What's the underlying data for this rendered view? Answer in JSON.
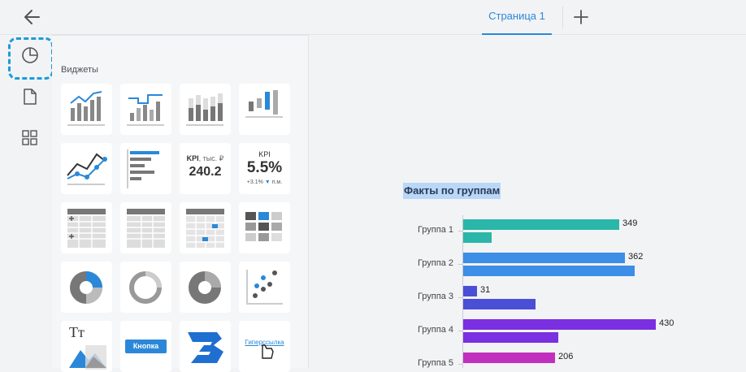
{
  "header": {
    "tab_label": "Страница 1",
    "back_icon": "arrow-left-icon",
    "add_icon": "plus-icon",
    "accent": "#2b88d8"
  },
  "sidebar": {
    "items": [
      {
        "icon": "pie-chart-icon",
        "active": true
      },
      {
        "icon": "document-icon",
        "active": false
      },
      {
        "icon": "grid-icon",
        "active": false
      }
    ]
  },
  "panel": {
    "title": "Виджеты",
    "kpi1": {
      "label": "KPI",
      "unit": ", тыс. ₽",
      "value": "240.2"
    },
    "kpi2": {
      "label": "KPI",
      "value": "5.5%",
      "delta": "+3.1%",
      "delta_suffix": "п.м."
    },
    "button_widget_label": "Кнопка",
    "hyperlink_widget_label": "Гиперссылка",
    "text_widget_label": "Тт"
  },
  "chart_data": {
    "type": "bar",
    "title": "Факты по группам",
    "orientation": "horizontal",
    "categories": [
      "Группа 1",
      "Группа 2",
      "Группа 3",
      "Группа 4",
      "Группа 5"
    ],
    "series": [
      {
        "values": [
          349,
          362,
          31,
          430,
          206
        ]
      },
      {
        "values": [
          64,
          383,
          162,
          212,
          null
        ]
      }
    ],
    "data_labels": [
      "349",
      "362",
      "31",
      "430",
      "206"
    ],
    "colors": [
      "#2ab6a8",
      "#3c8ee6",
      "#4a4fd6",
      "#7a2fe0",
      "#c22fbf"
    ]
  }
}
